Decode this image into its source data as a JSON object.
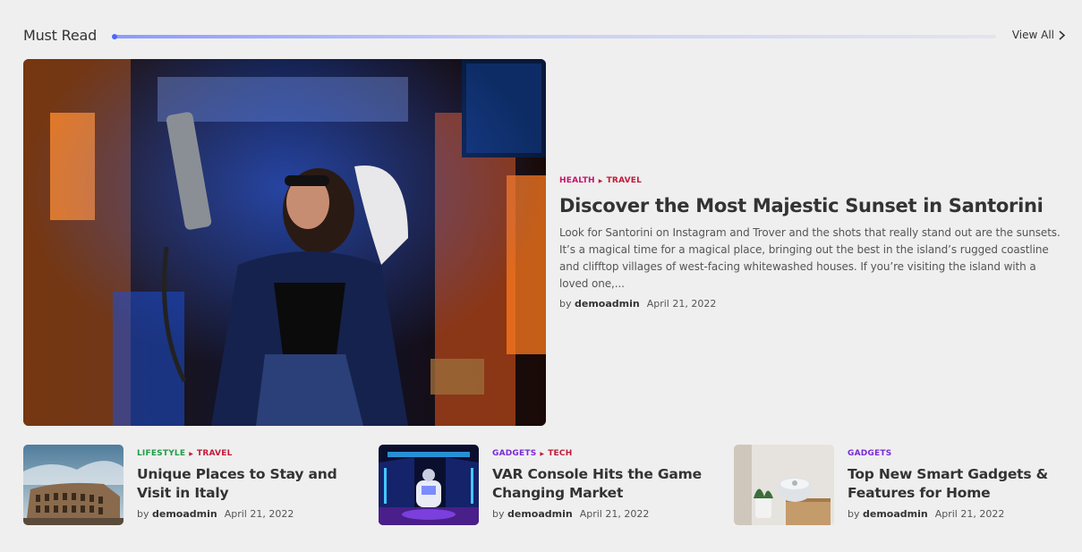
{
  "section": {
    "title": "Must Read",
    "view_all": "View All"
  },
  "hero": {
    "categories": [
      {
        "label": "HEALTH",
        "color": "#c2186a"
      },
      {
        "label": "TRAVEL",
        "color": "#c21a3a"
      }
    ],
    "title": "Discover the Most Majestic Sunset in Santorini",
    "excerpt": "Look for Santorini on Instagram and Trover and the shots that really stand out are the sunsets. It’s a magical time for a magical place, bringing out the best in the island’s rugged coastline and clifftop villages of west-facing whitewashed houses. If you’re visiting the island with a loved one,...",
    "by": "by",
    "author": "demoadmin",
    "date": "April 21, 2022"
  },
  "cards": [
    {
      "categories": [
        {
          "label": "LIFESTYLE",
          "color": "#1f9e46"
        },
        {
          "label": "TRAVEL",
          "color": "#c21a3a"
        }
      ],
      "title": "Unique Places to Stay and Visit in Italy",
      "by": "by",
      "author": "demoadmin",
      "date": "April 21, 2022"
    },
    {
      "categories": [
        {
          "label": "GADGETS",
          "color": "#7a2bd8"
        },
        {
          "label": "TECH",
          "color": "#c21a3a"
        }
      ],
      "title": "VAR Console Hits the Game Changing Market",
      "by": "by",
      "author": "demoadmin",
      "date": "April 21, 2022"
    },
    {
      "categories": [
        {
          "label": "GADGETS",
          "color": "#7a2bd8"
        }
      ],
      "title": "Top New Smart Gadgets & Features for Home",
      "by": "by",
      "author": "demoadmin",
      "date": "April 21, 2022"
    }
  ],
  "icons": {
    "view_all": "chevron-right-icon",
    "category_separator": "triangle-right-icon"
  }
}
